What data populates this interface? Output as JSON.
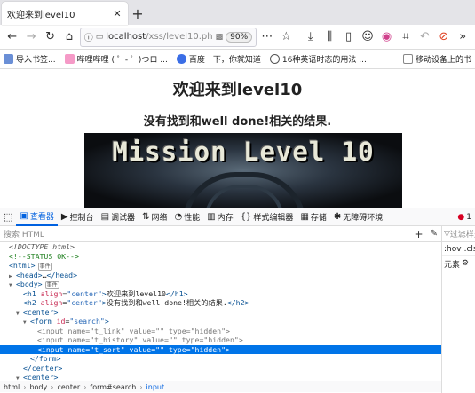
{
  "browser": {
    "tab_title": "欢迎来到level10",
    "url_host": "localhost",
    "url_path": "/xss/level10.ph",
    "zoom": "90%"
  },
  "bookmarks": [
    {
      "label": "导入书签...",
      "color": "#6a8fd6"
    },
    {
      "label": "哔哩哔哩 ( ゜- ゜)つロ ...",
      "color": "#f59ac7"
    },
    {
      "label": "百度一下，你就知道",
      "color": "#3b6ee6"
    },
    {
      "label": "16种英语时态的用法 ...",
      "color": "#555555"
    },
    {
      "label": "移动设备上的书",
      "color": "#888888"
    }
  ],
  "page": {
    "h1": "欢迎来到level10",
    "h2": "没有找到和well done!相关的结果.",
    "banner_text": "Mission Level 10"
  },
  "devtools": {
    "tabs": [
      {
        "label": "查看器",
        "icon": "inspector-icon",
        "glyph": "▣"
      },
      {
        "label": "控制台",
        "icon": "console-icon",
        "glyph": "▶"
      },
      {
        "label": "调试器",
        "icon": "debugger-icon",
        "glyph": "▤"
      },
      {
        "label": "网络",
        "icon": "network-icon",
        "glyph": "⇅"
      },
      {
        "label": "性能",
        "icon": "performance-icon",
        "glyph": "◔"
      },
      {
        "label": "内存",
        "icon": "memory-icon",
        "glyph": "▥"
      },
      {
        "label": "样式编辑器",
        "icon": "style-editor-icon",
        "glyph": "{}"
      },
      {
        "label": "存储",
        "icon": "storage-icon",
        "glyph": "▦"
      },
      {
        "label": "无障碍环境",
        "icon": "accessibility-icon",
        "glyph": "✱"
      }
    ],
    "error_count": "1",
    "search_placeholder": "搜索 HTML",
    "side": {
      "hov": ":hov",
      "cls": ".cls",
      "filter": "过滤样式",
      "elem": "元素"
    },
    "breadcrumbs": [
      "html",
      "body",
      "center",
      "form#search",
      "input"
    ],
    "badge_event": "事件"
  }
}
